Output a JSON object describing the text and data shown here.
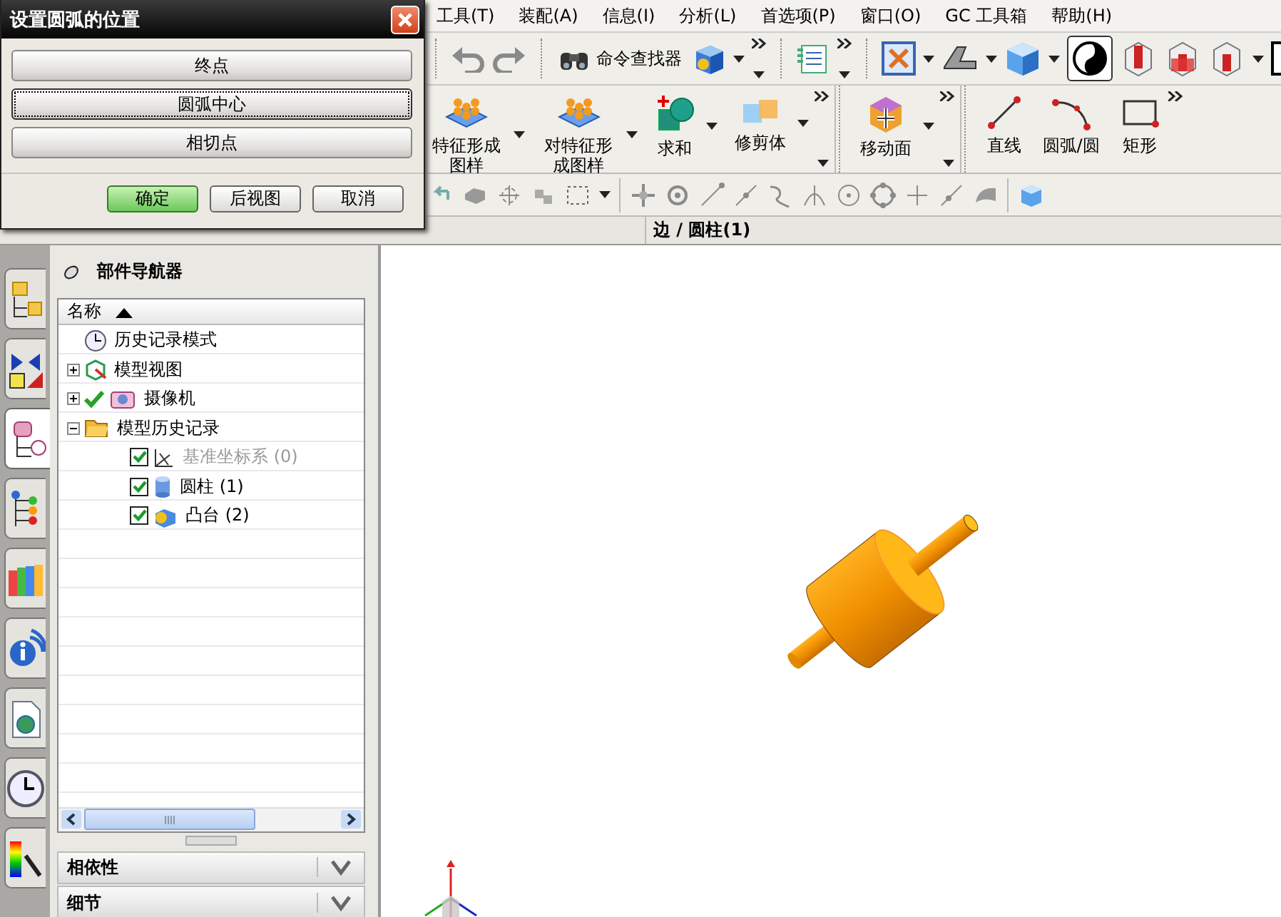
{
  "dialog": {
    "title": "设置圆弧的位置",
    "options": [
      {
        "label": "终点",
        "selected": false
      },
      {
        "label": "圆弧中心",
        "selected": true
      },
      {
        "label": "相切点",
        "selected": false
      }
    ],
    "buttons": [
      {
        "label": "确定",
        "default": true
      },
      {
        "label": "后视图",
        "default": false
      },
      {
        "label": "取消",
        "default": false
      }
    ]
  },
  "menu_bar": [
    "工具(T)",
    "装配(A)",
    "信息(I)",
    "分析(L)",
    "首选项(P)",
    "窗口(O)",
    "GC 工具箱",
    "帮助(H)"
  ],
  "standard_toolbar": {
    "command_finder": "命令查找器"
  },
  "ribbon": [
    {
      "buttons": [
        {
          "kind": "pattern",
          "label": "特征形成图样",
          "dropdown": true
        },
        {
          "kind": "pattern",
          "label": "对特征形成图样",
          "dropdown": true
        },
        {
          "kind": "unite",
          "label": "求和",
          "dropdown": true
        },
        {
          "kind": "trim",
          "label": "修剪体",
          "dropdown": true
        }
      ]
    },
    {
      "buttons": [
        {
          "kind": "move-face",
          "label": "移动面",
          "dropdown": true
        }
      ]
    },
    {
      "buttons": [
        {
          "kind": "line",
          "label": "直线",
          "dropdown": false
        },
        {
          "kind": "arc",
          "label": "圆弧/圆",
          "dropdown": false
        },
        {
          "kind": "rectangle",
          "label": "矩形",
          "dropdown": false
        }
      ]
    }
  ],
  "status": "边 / 圆柱(1)",
  "side_tabs": [
    {
      "kind": "assembly",
      "selected": false
    },
    {
      "kind": "constraints",
      "selected": false
    },
    {
      "kind": "part",
      "selected": true
    },
    {
      "kind": "reuse",
      "selected": false
    },
    {
      "kind": "library",
      "selected": false
    },
    {
      "kind": "info",
      "selected": false
    },
    {
      "kind": "web",
      "selected": false
    },
    {
      "kind": "history",
      "selected": false
    },
    {
      "kind": "palette",
      "selected": false
    }
  ],
  "navigator": {
    "title": "部件导航器",
    "column": "名称",
    "tree": [
      {
        "kind": "mode",
        "label": "历史记录模式",
        "checked": false,
        "disabled": false
      },
      {
        "kind": "view",
        "label": "模型视图",
        "expanded": false,
        "checked": false,
        "disabled": false
      },
      {
        "kind": "camera",
        "label": "摄像机",
        "expanded": false,
        "checked": true,
        "disabled": false
      },
      {
        "kind": "folder",
        "label": "模型历史记录",
        "expanded": true,
        "checked": false,
        "disabled": false,
        "children": [
          {
            "kind": "datum",
            "label": "基准坐标系 (0)",
            "checked": true,
            "disabled": true
          },
          {
            "kind": "cylinder",
            "label": "圆柱 (1)",
            "checked": true,
            "disabled": false
          },
          {
            "kind": "boss",
            "label": "凸台 (2)",
            "checked": true,
            "disabled": false
          }
        ]
      }
    ],
    "sections": [
      {
        "label": "相依性",
        "expanded": false
      },
      {
        "label": "细节",
        "expanded": false
      }
    ]
  }
}
